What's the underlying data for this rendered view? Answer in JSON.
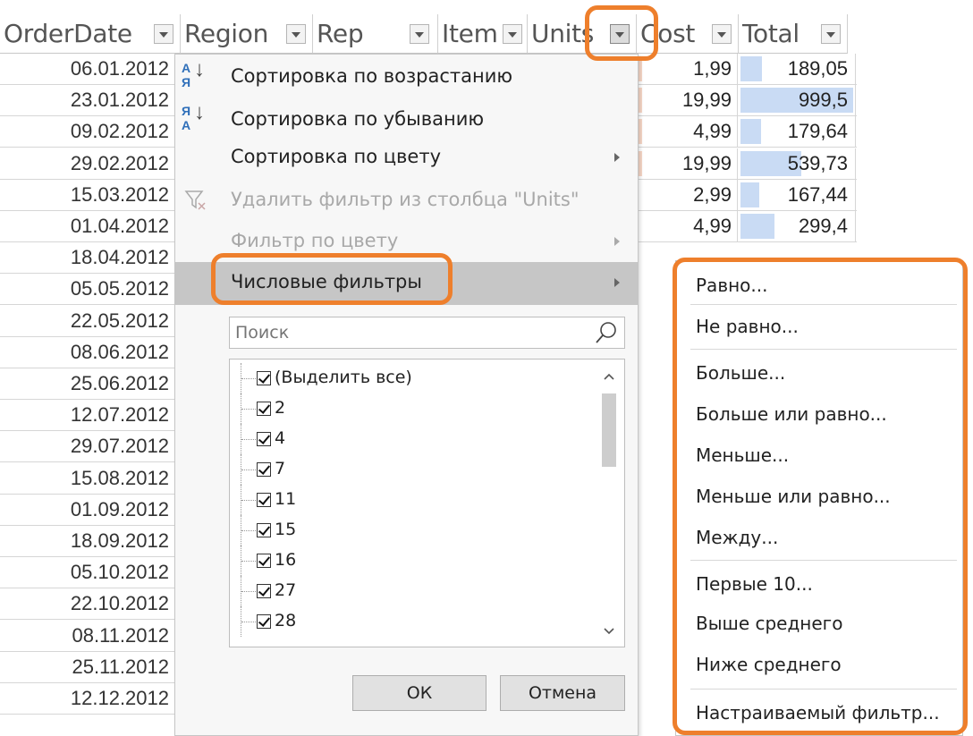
{
  "headers": [
    {
      "label": "OrderDate"
    },
    {
      "label": "Region"
    },
    {
      "label": "Rep"
    },
    {
      "label": "Item"
    },
    {
      "label": "Units"
    },
    {
      "label": "Cost"
    },
    {
      "label": "Total"
    }
  ],
  "dates": [
    "06.01.2012",
    "23.01.2012",
    "09.02.2012",
    "29.02.2012",
    "15.03.2012",
    "01.04.2012",
    "18.04.2012",
    "05.05.2012",
    "22.05.2012",
    "08.06.2012",
    "25.06.2012",
    "12.07.2012",
    "29.07.2012",
    "15.08.2012",
    "01.09.2012",
    "18.09.2012",
    "05.10.2012",
    "22.10.2012",
    "08.11.2012",
    "25.11.2012",
    "12.12.2012"
  ],
  "right_rows": [
    {
      "cost": "1,99",
      "total": "189,05",
      "total_fraction": 0.19
    },
    {
      "cost": "19,99",
      "total": "999,5",
      "total_fraction": 1.0
    },
    {
      "cost": "4,99",
      "total": "179,64",
      "total_fraction": 0.18
    },
    {
      "cost": "19,99",
      "total": "539,73",
      "total_fraction": 0.54
    },
    {
      "cost": "2,99",
      "total": "167,44",
      "total_fraction": 0.17
    },
    {
      "cost": "4,99",
      "total": "299,4",
      "total_fraction": 0.3
    }
  ],
  "menu": {
    "sort_asc": "Сортировка по возрастанию",
    "sort_desc": "Сортировка по убыванию",
    "sort_color": "Сортировка по цвету",
    "clear_filter": "Удалить фильтр из столбца \"Units\"",
    "filter_color": "Фильтр по цвету",
    "number_filters": "Числовые фильтры",
    "search_placeholder": "Поиск",
    "ok": "ОК",
    "cancel": "Отмена",
    "icon_sort_a": "А",
    "icon_sort_ya": "Я"
  },
  "values_list": [
    {
      "label": "(Выделить все)",
      "checked": true
    },
    {
      "label": "2",
      "checked": true
    },
    {
      "label": "4",
      "checked": true
    },
    {
      "label": "7",
      "checked": true
    },
    {
      "label": "11",
      "checked": true
    },
    {
      "label": "15",
      "checked": true
    },
    {
      "label": "16",
      "checked": true
    },
    {
      "label": "27",
      "checked": true
    },
    {
      "label": "28",
      "checked": true
    }
  ],
  "submenu": [
    "Равно...",
    "Не равно...",
    "Больше...",
    "Больше или равно...",
    "Меньше...",
    "Меньше или равно...",
    "Между...",
    "Первые 10...",
    "Выше среднего",
    "Ниже среднего",
    "Настраиваемый фильтр..."
  ],
  "colors": {
    "highlight": "#ee7f2c",
    "total_bar": "#c9dbf4",
    "cost_bar": "#f7d7c7"
  }
}
